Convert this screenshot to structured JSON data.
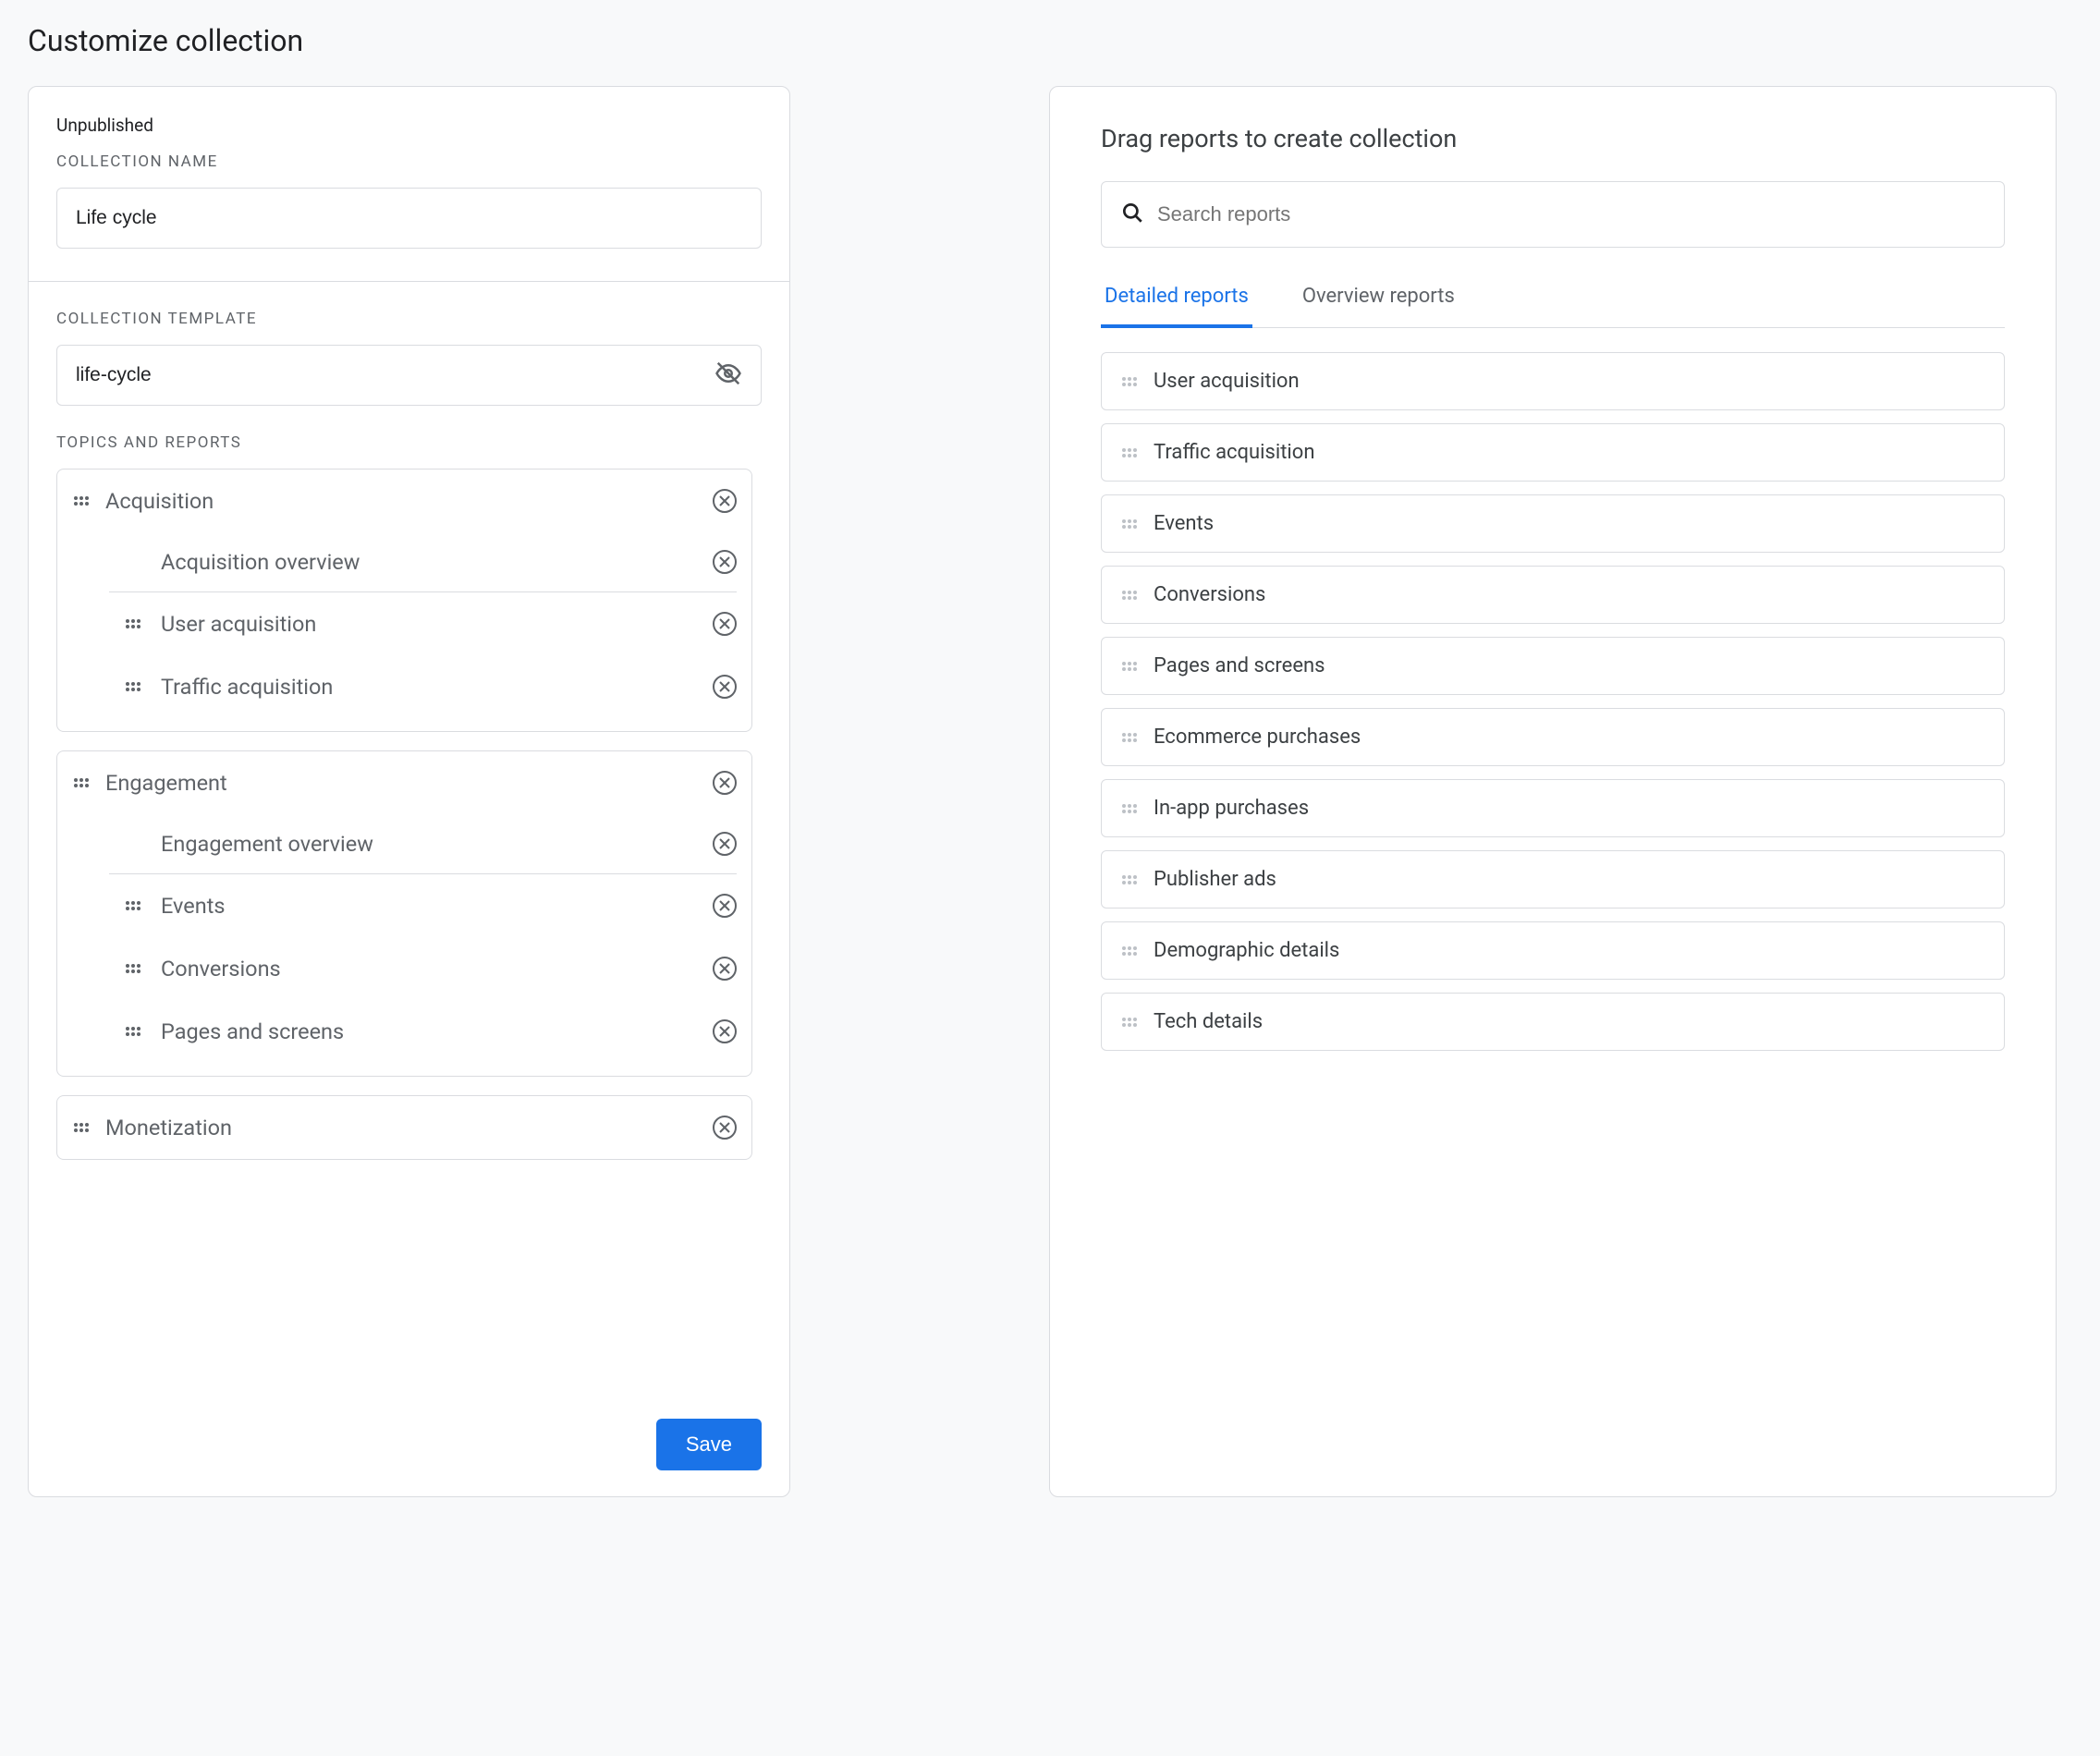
{
  "page_title": "Customize collection",
  "left": {
    "status": "Unpublished",
    "name_label": "COLLECTION NAME",
    "name_value": "Life cycle",
    "template_label": "COLLECTION TEMPLATE",
    "template_value": "life-cycle",
    "topics_label": "TOPICS AND REPORTS",
    "topics": [
      {
        "title": "Acquisition",
        "overview": "Acquisition overview",
        "reports": [
          "User acquisition",
          "Traffic acquisition"
        ]
      },
      {
        "title": "Engagement",
        "overview": "Engagement overview",
        "reports": [
          "Events",
          "Conversions",
          "Pages and screens"
        ]
      },
      {
        "title": "Monetization",
        "overview": null,
        "reports": []
      }
    ],
    "save_label": "Save"
  },
  "right": {
    "title": "Drag reports to create collection",
    "search_placeholder": "Search reports",
    "tabs": [
      "Detailed reports",
      "Overview reports"
    ],
    "active_tab": 0,
    "reports": [
      "User acquisition",
      "Traffic acquisition",
      "Events",
      "Conversions",
      "Pages and screens",
      "Ecommerce purchases",
      "In-app purchases",
      "Publisher ads",
      "Demographic details",
      "Tech details"
    ]
  }
}
